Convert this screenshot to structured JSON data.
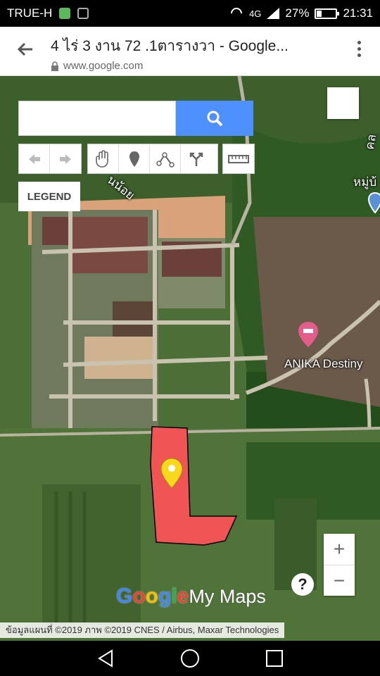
{
  "status_bar": {
    "carrier": "TRUE-H",
    "network": "4G",
    "battery_percent": "27%",
    "battery_level": 0.27,
    "time": "21:31"
  },
  "browser": {
    "page_title": "4 ไร่ 3 งาน 72 .1ตารางวา - Google...",
    "url": "www.google.com"
  },
  "map": {
    "search": {
      "placeholder": "",
      "value": ""
    },
    "toolbar": [
      "undo-icon",
      "redo-icon",
      "hand-icon",
      "marker-icon",
      "line-icon",
      "directions-icon",
      "ruler-icon"
    ],
    "legend_label": "LEGEND",
    "road_label_1": "นน้อย",
    "road_label_2": "หมู่บ้",
    "road_label_3": "คล",
    "poi_label": "ANIKA Destiny",
    "zoom_in": "+",
    "zoom_out": "−",
    "help": "?",
    "logo_google": "Google",
    "logo_mymaps": "My Maps",
    "attribution": "ข้อมูลแผนที่ ©2019 ภาพ ©2019 CNES / Airbus, Maxar Technologies",
    "colors": {
      "polygon": "#f05454",
      "marker": "#f9d71c",
      "search_button": "#4d90fe",
      "poi": "#e35c8a"
    }
  }
}
